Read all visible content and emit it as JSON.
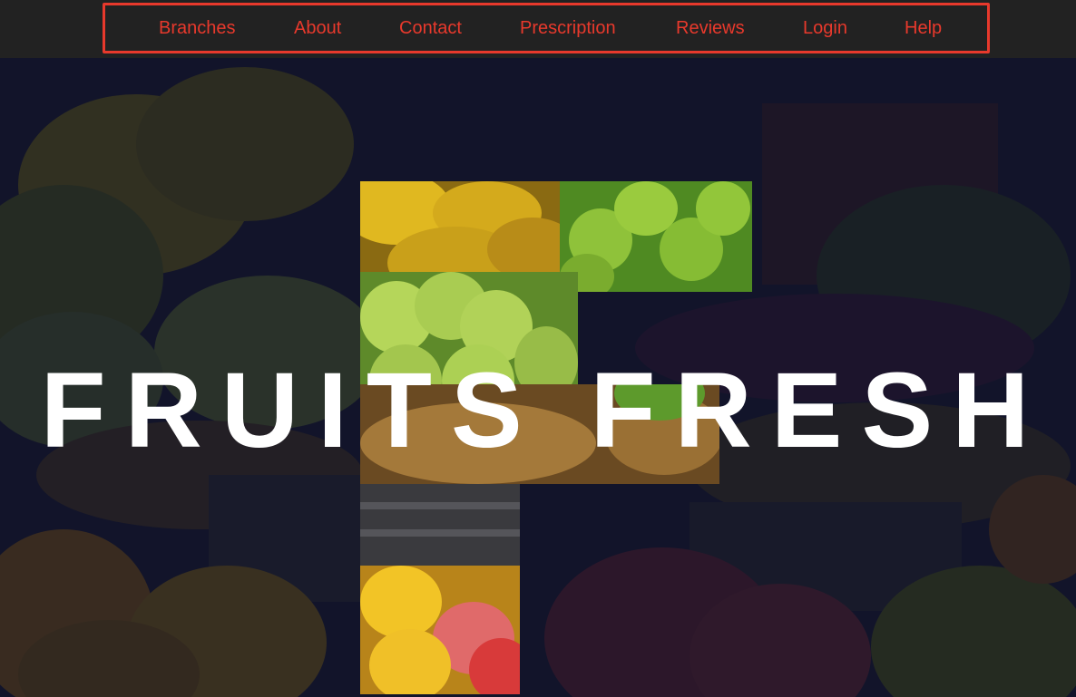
{
  "nav": {
    "items": [
      {
        "label": "Branches"
      },
      {
        "label": "About"
      },
      {
        "label": "Contact"
      },
      {
        "label": "Prescription"
      },
      {
        "label": "Reviews"
      },
      {
        "label": "Login"
      },
      {
        "label": "Help"
      }
    ],
    "accent_color": "#e8392c"
  },
  "hero": {
    "title": "FRUITS FRESH",
    "background_image": "fruit-market-photo",
    "letter_image": "fruit-baskets-photo"
  }
}
